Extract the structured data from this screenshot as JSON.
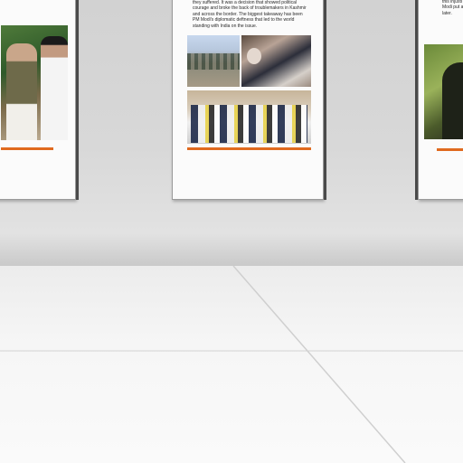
{
  "scene": {
    "center_panel_text": "they suffered. It was a decision that showed political\ncourage and broke the back of troublemakers in Kashmir\nand across the border. The biggest takeaway has been\nPM Modi's diplomatic deftness that led to the world\nstanding with India on the issue.",
    "right_panel_text": "this injusti\nModi put a\nlater.",
    "accent_color": "#e06a1f"
  }
}
